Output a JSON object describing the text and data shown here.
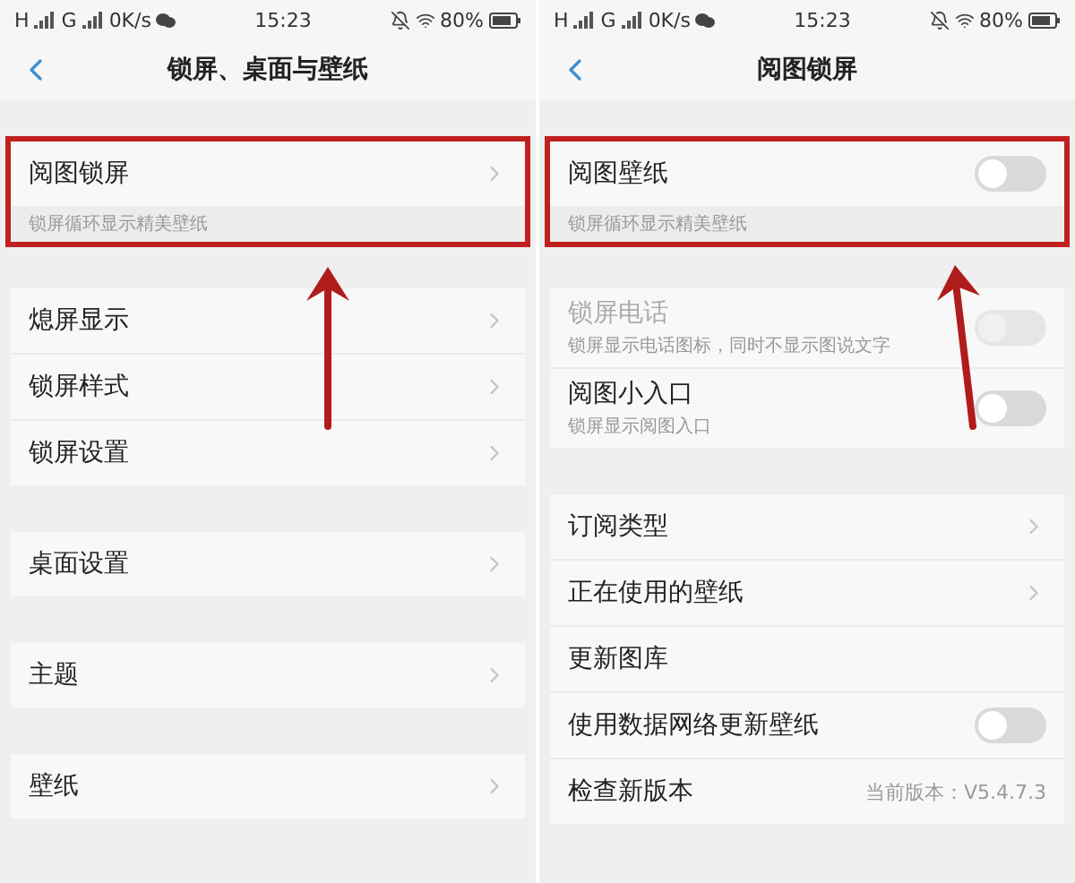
{
  "screens": [
    {
      "status_bar": {
        "network_1": "H",
        "network_2": "G",
        "speed": "0K/s",
        "time": "15:23",
        "battery": "80%"
      },
      "title": "锁屏、桌面与壁纸",
      "arrow": true,
      "groups": [
        {
          "highlighted": true,
          "items": [
            {
              "kind": "nav",
              "label": "阅图锁屏"
            }
          ],
          "footnote": "锁屏循环显示精美壁纸"
        },
        {
          "highlighted": false,
          "items": [
            {
              "kind": "nav",
              "label": "熄屏显示"
            },
            {
              "kind": "nav",
              "label": "锁屏样式"
            },
            {
              "kind": "nav",
              "label": "锁屏设置"
            }
          ]
        },
        {
          "highlighted": false,
          "items": [
            {
              "kind": "nav",
              "label": "桌面设置"
            }
          ]
        },
        {
          "highlighted": false,
          "items": [
            {
              "kind": "nav",
              "label": "主题"
            }
          ]
        },
        {
          "highlighted": false,
          "items": [
            {
              "kind": "nav",
              "label": "壁纸"
            }
          ]
        }
      ]
    },
    {
      "status_bar": {
        "network_1": "H",
        "network_2": "G",
        "speed": "0K/s",
        "time": "15:23",
        "battery": "80%"
      },
      "title": "阅图锁屏",
      "arrow": true,
      "groups": [
        {
          "highlighted": true,
          "items": [
            {
              "kind": "toggle",
              "label": "阅图壁纸",
              "on": false,
              "disabled": false
            }
          ],
          "footnote": "锁屏循环显示精美壁纸"
        },
        {
          "highlighted": false,
          "items": [
            {
              "kind": "toggle",
              "label": "锁屏电话",
              "description": "锁屏显示电话图标，同时不显示图说文字",
              "on": false,
              "disabled": true
            },
            {
              "kind": "toggle",
              "label": "阅图小入口",
              "description": "锁屏显示阅图入口",
              "on": false,
              "disabled": false
            }
          ]
        },
        {
          "highlighted": false,
          "items": [
            {
              "kind": "nav",
              "label": "订阅类型"
            },
            {
              "kind": "nav",
              "label": "正在使用的壁纸"
            },
            {
              "kind": "plain",
              "label": "更新图库"
            },
            {
              "kind": "toggle",
              "label": "使用数据网络更新壁纸",
              "on": false,
              "disabled": false
            },
            {
              "kind": "value",
              "label": "检查新版本",
              "value": "当前版本：V5.4.7.3"
            }
          ]
        }
      ]
    }
  ]
}
